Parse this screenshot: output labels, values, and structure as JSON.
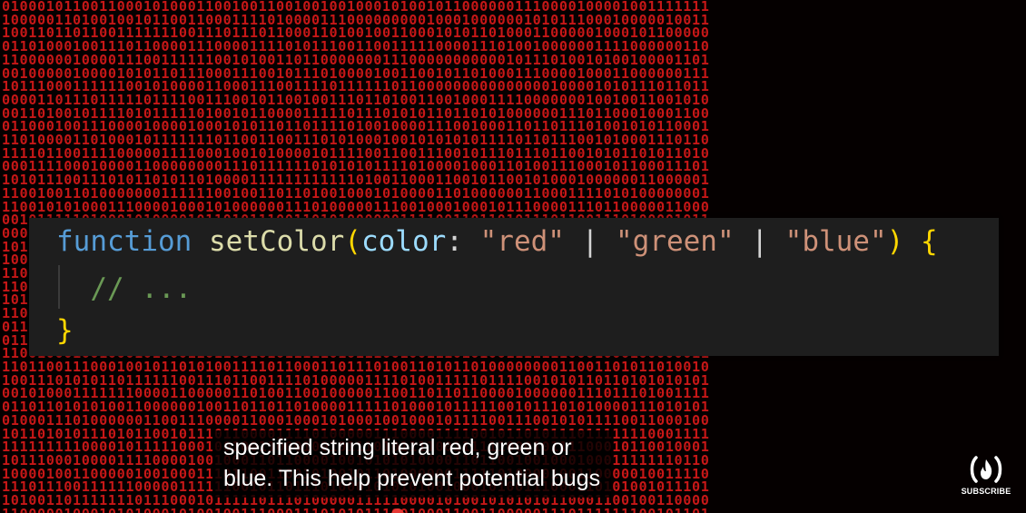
{
  "code": {
    "keyword": "function",
    "function_name": "setColor",
    "open_paren": "(",
    "param": "color",
    "colon": ":",
    "str_red": "\"red\"",
    "pipe1": "|",
    "str_green": "\"green\"",
    "pipe2": "|",
    "str_blue": "\"blue\"",
    "close_paren": ")",
    "open_brace": "{",
    "comment": "// ...",
    "close_brace": "}"
  },
  "caption": {
    "line1": "specified string literal red, green or",
    "line2": "blue. This help prevent potential bugs"
  },
  "subscribe": {
    "label": "SUBSCRIBE"
  },
  "colors": {
    "background_digits": "#d81a1a",
    "code_panel": "#1e1e1e",
    "keyword": "#569cd6",
    "function": "#dcdcaa",
    "param": "#9cdcfe",
    "string": "#ce9178",
    "brace": "#ffd700",
    "comment": "#6a9955"
  }
}
